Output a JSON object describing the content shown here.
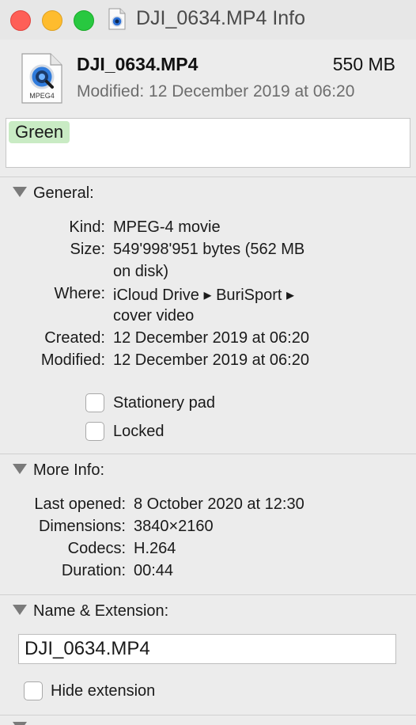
{
  "window": {
    "title": "DJI_0634.MP4 Info"
  },
  "header": {
    "file_name": "DJI_0634.MP4",
    "file_size": "550 MB",
    "modified": "Modified: 12 December 2019 at 06:20",
    "icon_label": "MPEG4"
  },
  "tags": {
    "items": [
      "Green"
    ],
    "color": "#c9ebc4"
  },
  "general": {
    "heading": "General:",
    "kind_label": "Kind:",
    "kind_value": "MPEG-4 movie",
    "size_label": "Size:",
    "size_value_line1": "549'998'951 bytes (562 MB",
    "size_value_line2": "on disk)",
    "where_label": "Where:",
    "where_value_line1": "iCloud Drive ▸ BuriSport ▸",
    "where_value_line2": "cover video",
    "created_label": "Created:",
    "created_value": "12 December 2019 at 06:20",
    "modified_label": "Modified:",
    "modified_value": "12 December 2019 at 06:20",
    "stationery_label": "Stationery pad",
    "stationery_checked": false,
    "locked_label": "Locked",
    "locked_checked": false
  },
  "more_info": {
    "heading": "More Info:",
    "last_opened_label": "Last opened:",
    "last_opened_value": "8 October 2020 at 12:30",
    "dimensions_label": "Dimensions:",
    "dimensions_value": "3840×2160",
    "codecs_label": "Codecs:",
    "codecs_value": "H.264",
    "duration_label": "Duration:",
    "duration_value": "00:44"
  },
  "name_extension": {
    "heading": "Name & Extension:",
    "name_value": "DJI_0634.MP4",
    "hide_extension_label": "Hide extension",
    "hide_extension_checked": false
  },
  "colors": {
    "close": "#fe5f57",
    "minimize": "#febc2e",
    "maximize": "#28c840",
    "background": "#ececec"
  }
}
